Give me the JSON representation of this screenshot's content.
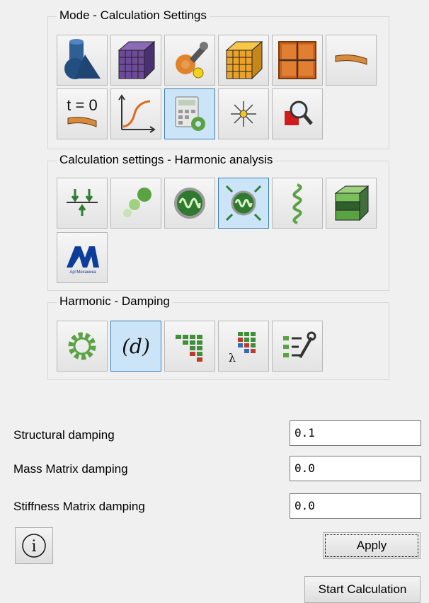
{
  "groups": {
    "mode": {
      "title": "Mode - Calculation Settings",
      "buttons": [
        {
          "icon": "geometry-shapes-icon"
        },
        {
          "icon": "mesh-cube-icon"
        },
        {
          "icon": "tools-properties-icon"
        },
        {
          "icon": "orange-mesh-cube-icon"
        },
        {
          "icon": "grid-frame-icon"
        },
        {
          "icon": "beam-section-icon"
        },
        {
          "icon": "initial-condition-icon",
          "text": "t = 0"
        },
        {
          "icon": "result-curve-icon"
        },
        {
          "icon": "calculator-settings-icon",
          "selected": true
        },
        {
          "icon": "burst-icon"
        },
        {
          "icon": "zoom-search-icon"
        }
      ]
    },
    "calc": {
      "title": "Calculation settings - Harmonic analysis",
      "buttons": [
        {
          "icon": "supports-loads-icon"
        },
        {
          "icon": "mass-points-icon"
        },
        {
          "icon": "harmonic-wave-icon"
        },
        {
          "icon": "harmonic-excitation-icon",
          "selected": true
        },
        {
          "icon": "spring-coil-icon"
        },
        {
          "icon": "layered-box-icon"
        },
        {
          "icon": "apm-logo-icon",
          "text": "АртМеханика"
        }
      ]
    },
    "damping": {
      "title": "Harmonic - Damping",
      "buttons": [
        {
          "icon": "gear-icon"
        },
        {
          "icon": "damping-d-icon",
          "text": "(d)",
          "selected": true
        },
        {
          "icon": "matrix-staircase-icon"
        },
        {
          "icon": "lambda-matrix-icon",
          "text": "λ"
        },
        {
          "icon": "settings-list-icon"
        }
      ]
    }
  },
  "fields": {
    "structural": {
      "label": "Structural damping",
      "value": "0.1"
    },
    "mass": {
      "label": "Mass Matrix damping",
      "value": "0.0"
    },
    "stiffness": {
      "label": "Stiffness Matrix damping",
      "value": "0.0"
    }
  },
  "buttons": {
    "info_glyph": "i",
    "apply": "Apply",
    "start": "Start Calculation"
  }
}
